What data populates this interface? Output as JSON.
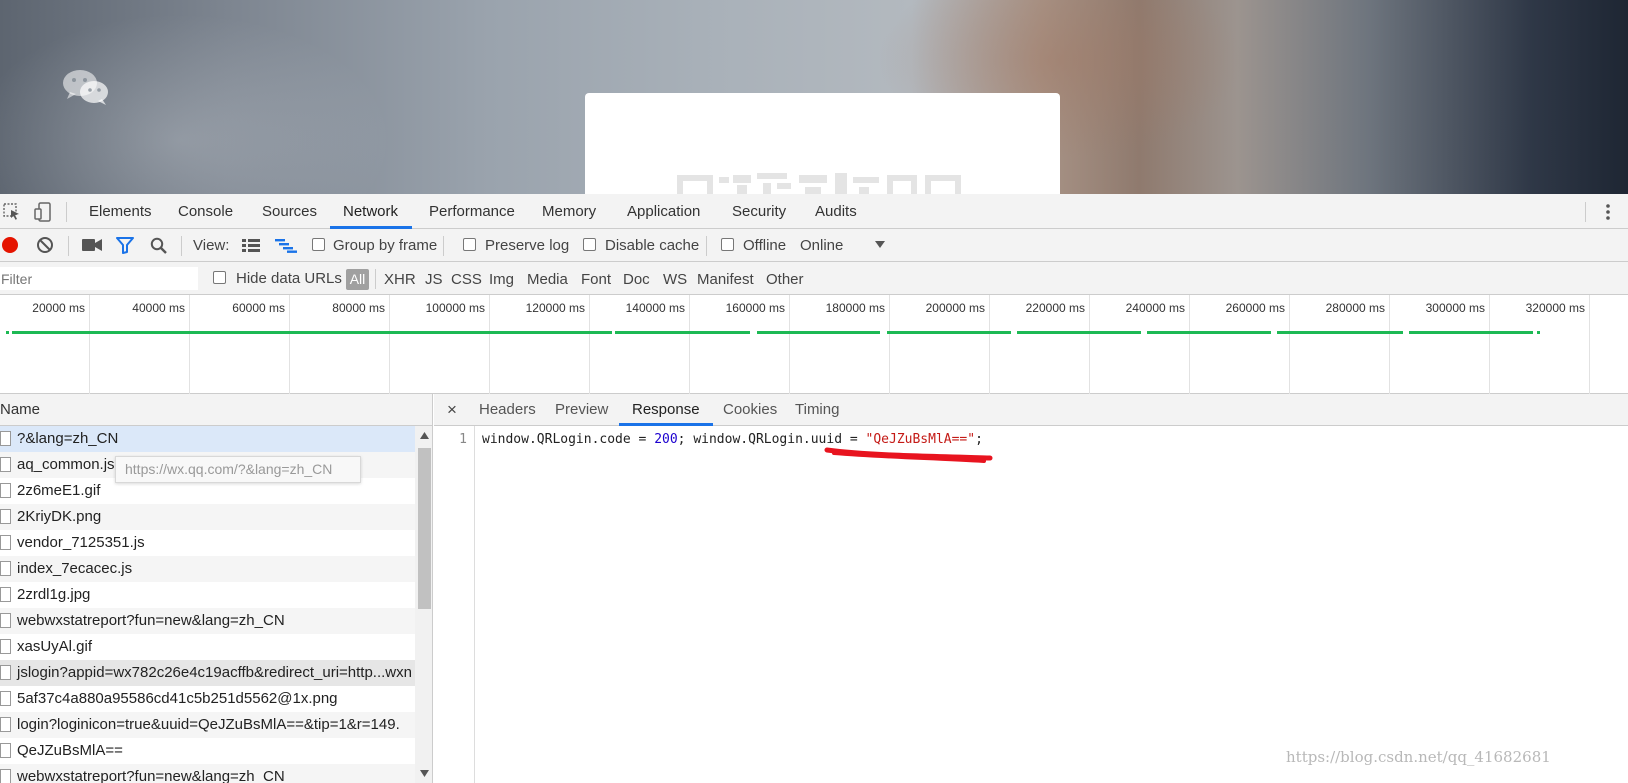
{
  "main_tabs": [
    "Elements",
    "Console",
    "Sources",
    "Network",
    "Performance",
    "Memory",
    "Application",
    "Security",
    "Audits"
  ],
  "active_main_tab": "Network",
  "toolbar": {
    "view_label": "View:",
    "group_by_frame": "Group by frame",
    "preserve_log": "Preserve log",
    "disable_cache": "Disable cache",
    "offline": "Offline",
    "throttling": "Online"
  },
  "filter": {
    "placeholder": "Filter",
    "hide_data_urls": "Hide data URLs",
    "types": [
      "All",
      "XHR",
      "JS",
      "CSS",
      "Img",
      "Media",
      "Font",
      "Doc",
      "WS",
      "Manifest",
      "Other"
    ]
  },
  "timeline_ticks": [
    "20000 ms",
    "40000 ms",
    "60000 ms",
    "80000 ms",
    "100000 ms",
    "120000 ms",
    "140000 ms",
    "160000 ms",
    "180000 ms",
    "200000 ms",
    "220000 ms",
    "240000 ms",
    "260000 ms",
    "280000 ms",
    "300000 ms",
    "320000 ms"
  ],
  "requests": {
    "column": "Name",
    "rows": [
      "?&lang=zh_CN",
      "aq_common.js",
      "2z6meE1.gif",
      "2KriyDK.png",
      "vendor_7125351.js",
      "index_7ecacec.js",
      "2zrdl1g.jpg",
      "webwxstatreport?fun=new&lang=zh_CN",
      "xasUyAl.gif",
      "jslogin?appid=wx782c26e4c19acffb&redirect_uri=http...wxn",
      "5af37c4a880a95586cd41c5b251d5562@1x.png",
      "login?loginicon=true&uuid=QeJZuBsMlA==&tip=1&r=149.",
      "QeJZuBsMlA==",
      "webwxstatreport?fun=new&lang=zh_CN"
    ],
    "tooltip": "https://wx.qq.com/?&lang=zh_CN"
  },
  "detail": {
    "close": "×",
    "tabs": [
      "Headers",
      "Preview",
      "Response",
      "Cookies",
      "Timing"
    ],
    "active_tab": "Response",
    "line_number": "1",
    "code": {
      "part1": "window.QRLogin.code = ",
      "num": "200",
      "part2": "; window.QRLogin.uuid = ",
      "str": "\"QeJZuBsMlA==\"",
      "part3": ";"
    }
  },
  "watermark": "https://blog.csdn.net/qq_41682681",
  "colors": {
    "accent": "#1a73e8",
    "record": "#e51400",
    "waterfall": "#1db954",
    "filter_icon": "#1a73e8"
  }
}
